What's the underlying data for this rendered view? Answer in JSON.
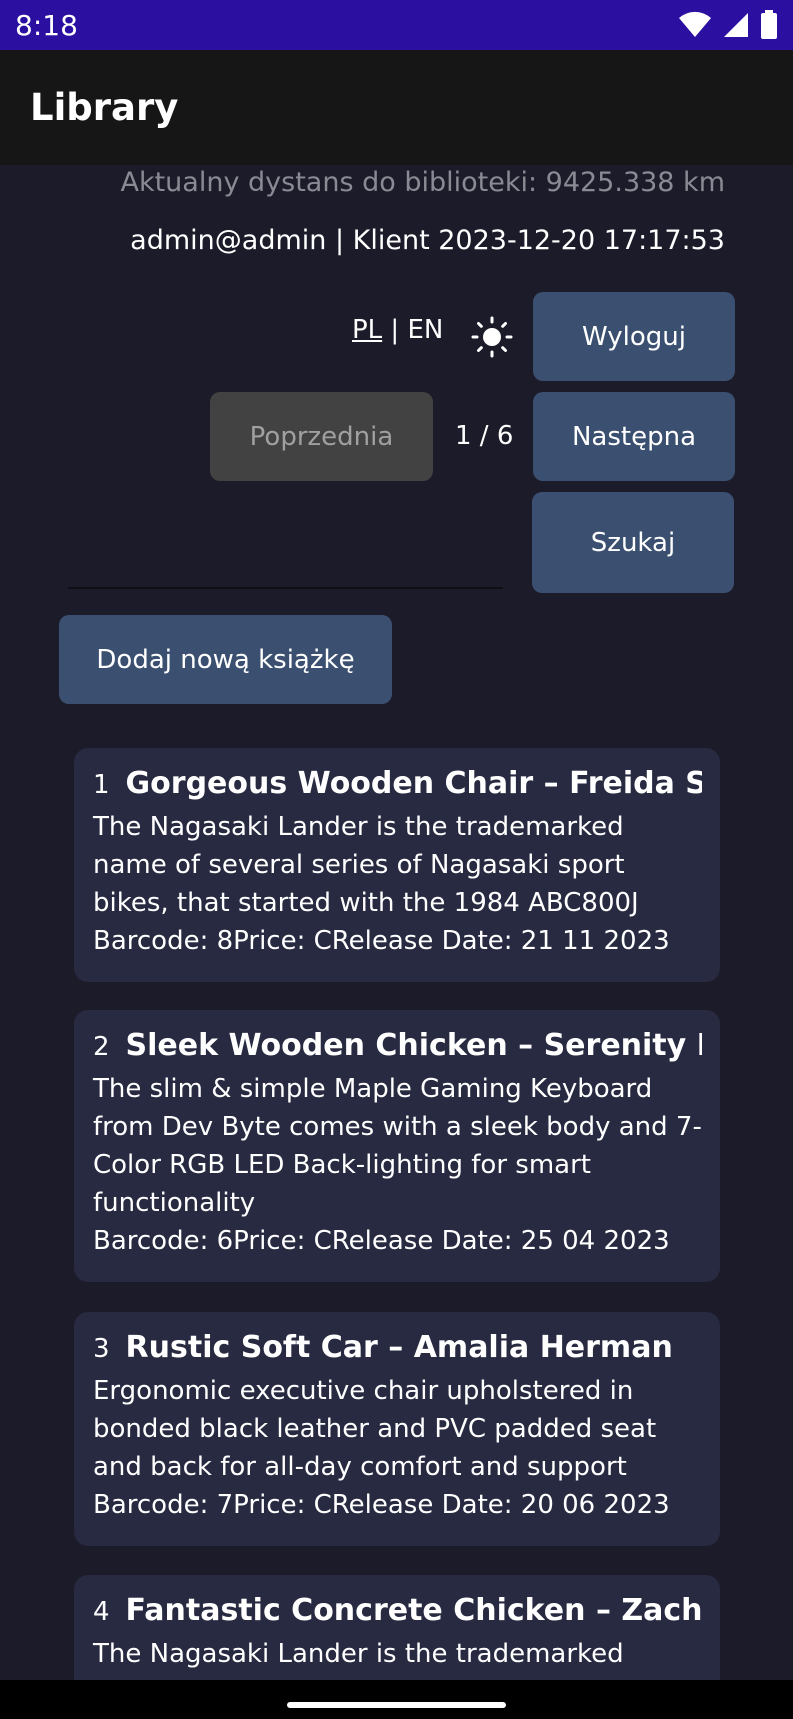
{
  "status": {
    "time": "8:18"
  },
  "app": {
    "title": "Library"
  },
  "header": {
    "distance": "Aktualny dystans do biblioteki: 9425.338 km",
    "user_info": "admin@admin | Klient 2023-12-20 17:17:53"
  },
  "lang": {
    "pl": "PL",
    "separator": " | ",
    "en": "EN"
  },
  "buttons": {
    "logout": "Wyloguj",
    "previous": "Poprzednia",
    "next": "Następna",
    "search": "Szukaj",
    "add_book": "Dodaj nową książkę"
  },
  "pagination": {
    "indicator": "1 / 6"
  },
  "books": [
    {
      "index": "1",
      "title": "Gorgeous Wooden Chair  –  Freida Simonis",
      "description": "The Nagasaki Lander is the trademarked name of several series of Nagasaki sport bikes, that started with the 1984 ABC800J",
      "meta": "Barcode: 8Price: CRelease Date:  21 11 2023"
    },
    {
      "index": "2",
      "title": "Sleek Wooden Chicken  –  Serenity Botsford",
      "description": "The slim & simple Maple Gaming Keyboard from Dev Byte comes with a sleek body and 7- Color RGB LED Back-lighting for smart functionality",
      "meta": "Barcode: 6Price: CRelease Date:  25 04 2023"
    },
    {
      "index": "3",
      "title": "Rustic Soft Car  –  Amalia Herman",
      "description": "Ergonomic executive chair upholstered in bonded black leather and PVC padded seat and back for all-day comfort and support",
      "meta": "Barcode: 7Price: CRelease Date:  20 06 2023"
    },
    {
      "index": "4",
      "title": "Fantastic Concrete Chicken  –  Zacharias",
      "description": "The Nagasaki Lander is the trademarked name",
      "meta": ""
    }
  ],
  "icons": {
    "wifi": "wifi-icon",
    "signal": "signal-icon",
    "battery": "battery-icon",
    "theme": "sun-icon"
  }
}
